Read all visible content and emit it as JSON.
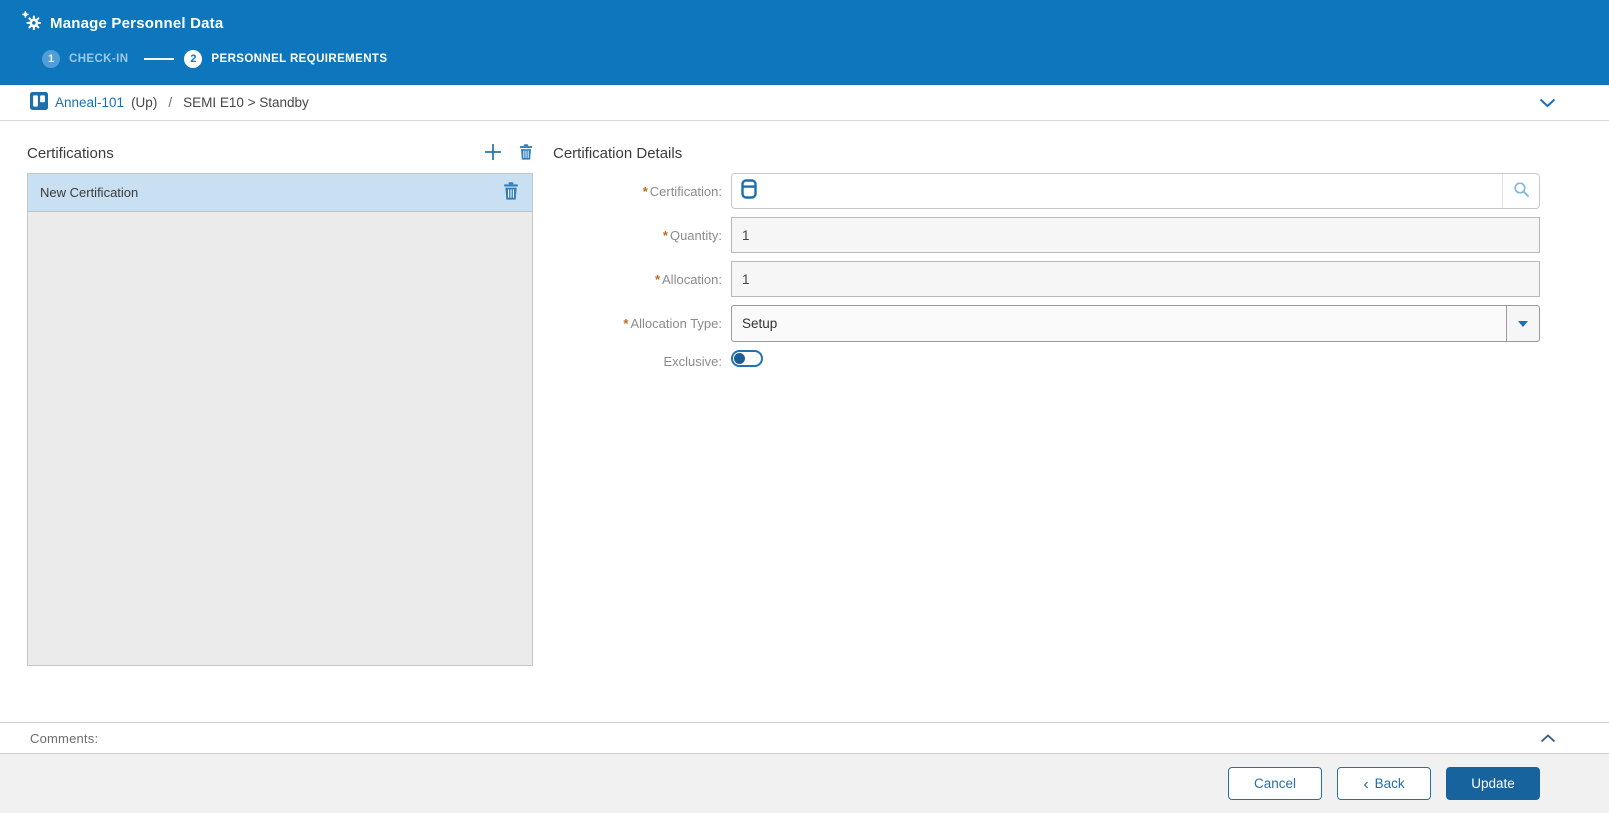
{
  "app": {
    "title": "Manage Personnel Data"
  },
  "stepper": {
    "steps": [
      {
        "number": "1",
        "label": "CHECK-IN",
        "active": false
      },
      {
        "number": "2",
        "label": "PERSONNEL REQUIREMENTS",
        "active": true
      }
    ]
  },
  "breadcrumb": {
    "entity": "Anneal-101",
    "status": "(Up)",
    "separator": "/",
    "location": "SEMI E10 > Standby"
  },
  "certifications_panel": {
    "title": "Certifications",
    "items": [
      {
        "name": "New Certification",
        "selected": true
      }
    ]
  },
  "details_panel": {
    "title": "Certification Details",
    "required_marker": "*",
    "fields": {
      "certification": {
        "label": "Certification:",
        "required": true,
        "value": ""
      },
      "quantity": {
        "label": "Quantity:",
        "required": true,
        "value": "1"
      },
      "allocation": {
        "label": "Allocation:",
        "required": true,
        "value": "1"
      },
      "allocation_type": {
        "label": "Allocation Type:",
        "required": true,
        "value": "Setup"
      },
      "exclusive": {
        "label": "Exclusive:",
        "required": false,
        "state": "off"
      }
    }
  },
  "comments": {
    "label": "Comments:"
  },
  "footer": {
    "cancel_label": "Cancel",
    "back_chevron": "‹",
    "back_label": "Back",
    "update_label": "Update"
  },
  "icons": {
    "header": "manage-gear-icon",
    "breadcrumb": "equipment-icon",
    "panel": [
      "add-icon",
      "delete-icon"
    ],
    "certification_field": [
      "certification-icon",
      "search-icon"
    ],
    "collapse": [
      "chevron-down-icon",
      "chevron-up-icon"
    ]
  },
  "colors": {
    "header_bg": "#0e76bd",
    "accent_blue": "#1a6fb5",
    "primary_button": "#16639e",
    "selected_item_bg": "#c9dff2",
    "required_marker": "#bf6a1f"
  }
}
